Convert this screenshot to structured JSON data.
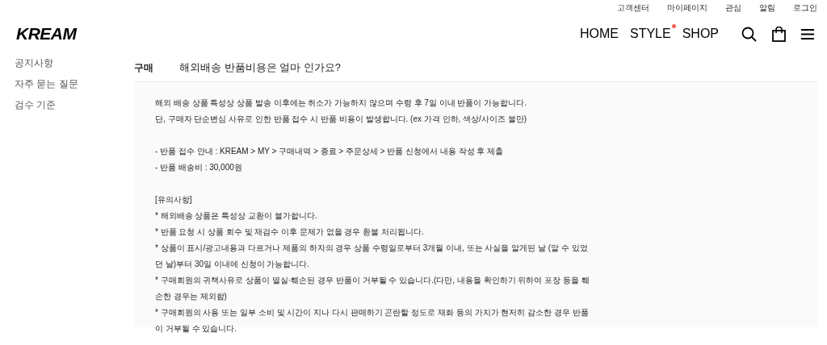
{
  "top_links": [
    "고객센터",
    "마이페이지",
    "관심",
    "알림",
    "로그인"
  ],
  "logo": "KREAM",
  "nav": [
    {
      "label": "HOME",
      "dot": false
    },
    {
      "label": "STYLE",
      "dot": true
    },
    {
      "label": "SHOP",
      "dot": false
    }
  ],
  "sidebar": {
    "items": [
      "공지사항",
      "자주 묻는 질문",
      "검수 기준"
    ]
  },
  "faq": {
    "category": "구매",
    "question": "해외배송 반품비용은 얼마 인가요?",
    "answer": [
      [
        "해외 배송 상품 특성상 상품 발송 이후에는 취소가 가능하지 않으며 수령 후 7일 이내 반품이 가능합니다.",
        "단, 구매자 단순변심 사유로 인한 반품 접수 시 반품 비용이 발생합니다. (ex 가격 인하, 색상/사이즈 불만)"
      ],
      [
        "- 반품 접수 안내 : KREAM > MY > 구매내역 > 종료 > 주문상세 > 반품 신청에서 내용 작성 후 제출",
        "- 반품 배송비 : 30,000원"
      ],
      [
        "[유의사항]",
        "* 해외배송 상품은 특성상 교환이 불가합니다.",
        "* 반품 요청 시 상품 회수 및 재검수 이후 문제가 없을 경우 환불 처리됩니다.",
        "* 상품이 표시/광고내용과 다르거나 제품의 하자의 경우 상품 수령일로부터 3개월 이내, 또는 사실을 알게된 날 (알 수 있었던 날)부터 30일 이내에 신청이 가능합니다.",
        "* 구매회원의 귀책사유로 상품이 멸실·훼손된 경우 반품이 거부될 수 있습니다.(다만, 내용을 확인하기 위하여 포장 등을 훼손한 경우는 제외함)",
        "* 구매회원의 사용 또는 일부 소비 및 시간이 지나 다시 판매하기 곤란할 정도로 재화 등의 가치가 현저히 감소한 경우 반품이 거부될 수 있습니다."
      ]
    ]
  }
}
